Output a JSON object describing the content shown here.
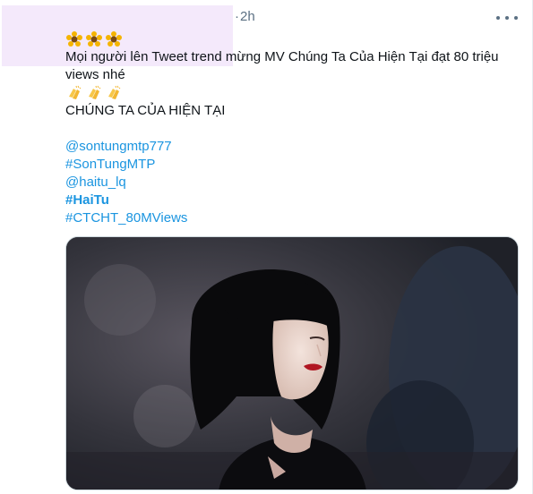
{
  "tweet": {
    "time": "2h",
    "separator": "·",
    "emoji_top": [
      "sunflower",
      "sunflower",
      "sunflower"
    ],
    "text_line1": "Mọi người lên Tweet trend mừng MV Chúng Ta Của Hiện Tại đạt 80 triệu views nhé",
    "emoji_mid": [
      "clapping-hands",
      "clapping-hands",
      "clapping-hands"
    ],
    "title_caps": "CHÚNG TA CỦA HIỆN TẠI",
    "mention1": "@sontungmtp777",
    "hashtag1": "#SonTungMTP",
    "mention2": "@haitu_lq",
    "hashtag2": "#HaiTu",
    "hashtag3": "#CTCHT_80MViews"
  },
  "colors": {
    "link": "#1b95e0",
    "muted": "#5b7083",
    "redaction": "#f4e9fb"
  },
  "icons": {
    "more": "more-horizontal-icon"
  }
}
